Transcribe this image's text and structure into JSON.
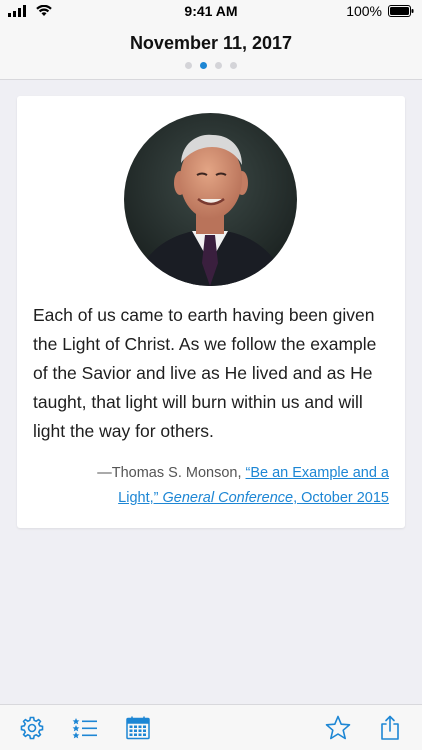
{
  "status_bar": {
    "time": "9:41 AM",
    "battery": "100%"
  },
  "header": {
    "title": "November 11, 2017",
    "page_count": 4,
    "active_page": 2
  },
  "quote": {
    "text": "Each of us came to earth having been given the Light of Christ. As we follow the example of the Savior and live as He lived and as He taught, that light will burn within us and will light the way for others.",
    "author_prefix": "—Thomas S. Monson,",
    "source_title": "“Be an Example and a Light,”",
    "source_publication": "General Conference",
    "source_date": ", October 2015"
  },
  "tab_bar": {
    "icons": [
      "gear-icon",
      "list-icon",
      "calendar-icon",
      "star-icon",
      "share-icon"
    ]
  },
  "colors": {
    "accent": "#1d86d4",
    "background": "#efeff4",
    "card": "#ffffff"
  }
}
